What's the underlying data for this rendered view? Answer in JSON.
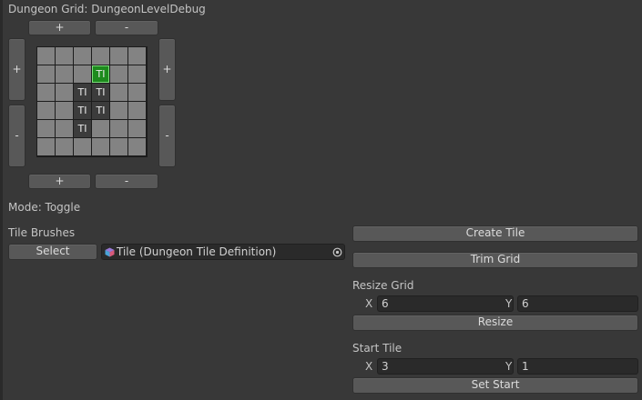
{
  "header": {
    "title": "Dungeon Grid: DungeonLevelDebug"
  },
  "grid_controls": {
    "plus": "+",
    "minus": "-"
  },
  "grid": {
    "rows": [
      [
        "",
        "",
        "",
        "",
        "",
        ""
      ],
      [
        "",
        "",
        "",
        "TI",
        "",
        ""
      ],
      [
        "",
        "",
        "TI",
        "TI",
        "",
        ""
      ],
      [
        "",
        "",
        "TI",
        "TI",
        "",
        ""
      ],
      [
        "",
        "",
        "TI",
        "",
        "",
        ""
      ],
      [
        "",
        "",
        "",
        "",
        "",
        ""
      ]
    ],
    "start_cell_label": "TI"
  },
  "mode": {
    "label": "Mode: Toggle"
  },
  "tile_brushes": {
    "section_label": "Tile Brushes",
    "select_label": "Select",
    "object_value": "Tile (Dungeon Tile Definition)",
    "object_icon": "tile-asset-icon",
    "picker_icon": "target-picker-icon"
  },
  "actions": {
    "create_tile": "Create Tile",
    "trim_grid": "Trim Grid"
  },
  "resize_grid": {
    "section_label": "Resize Grid",
    "x_label": "X",
    "x_value": "6",
    "y_label": "Y",
    "y_value": "6",
    "button_label": "Resize"
  },
  "start_tile": {
    "section_label": "Start Tile",
    "x_label": "X",
    "x_value": "3",
    "y_label": "Y",
    "y_value": "1",
    "button_label": "Set Start"
  },
  "colors": {
    "background": "#383838",
    "button": "#585858",
    "field": "#2a2a2a",
    "cell_empty": "#838383",
    "cell_tile": "#3c3c3c",
    "cell_start": "#1d8a1d"
  }
}
